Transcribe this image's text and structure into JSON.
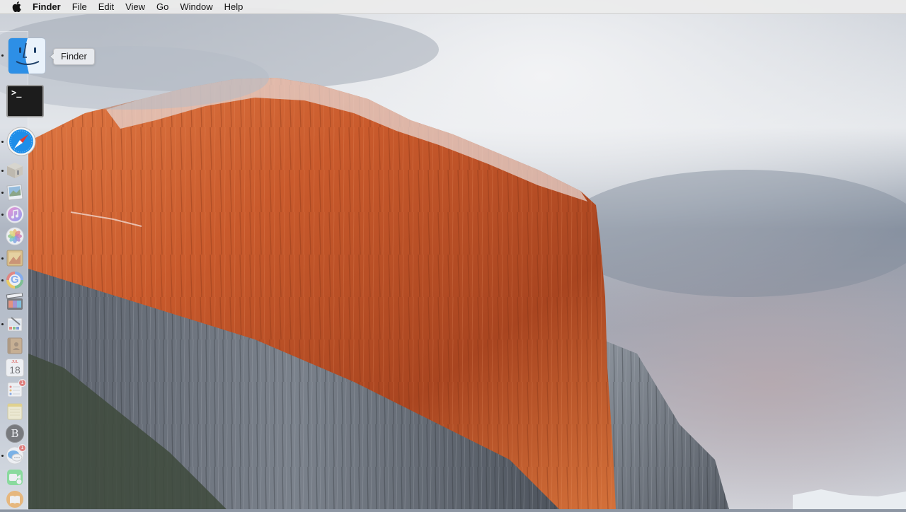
{
  "menubar": {
    "apple_icon": "apple-logo-icon",
    "app_name": "Finder",
    "items": [
      "File",
      "Edit",
      "View",
      "Go",
      "Window",
      "Help"
    ]
  },
  "dock": {
    "orientation": "left",
    "tooltip": "Finder",
    "items": [
      {
        "name": "Finder",
        "icon": "finder-icon",
        "running": true
      },
      {
        "name": "Terminal",
        "icon": "terminal-icon",
        "running": false,
        "glyph": ">_"
      },
      {
        "name": "Safari",
        "icon": "safari-icon",
        "running": true
      },
      {
        "name": "Archive",
        "icon": "archive-box-icon",
        "running": true
      },
      {
        "name": "Preview",
        "icon": "preview-icon",
        "running": true
      },
      {
        "name": "iTunes",
        "icon": "itunes-icon",
        "running": true
      },
      {
        "name": "Photos",
        "icon": "photos-icon",
        "running": false
      },
      {
        "name": "Image Viewer",
        "icon": "image-viewer-icon",
        "running": true
      },
      {
        "name": "Google Chrome",
        "icon": "google-icon",
        "running": true,
        "glyph": "G"
      },
      {
        "name": "Final Cut Pro",
        "icon": "final-cut-icon",
        "running": false
      },
      {
        "name": "Pixelmator",
        "icon": "paint-icon",
        "running": true
      },
      {
        "name": "Contacts",
        "icon": "contacts-book-icon",
        "running": false
      },
      {
        "name": "Calendar",
        "icon": "calendar-icon",
        "running": false,
        "month": "JUL",
        "day": "18"
      },
      {
        "name": "Reminders",
        "icon": "reminders-icon",
        "running": false,
        "badge": "1"
      },
      {
        "name": "Notes",
        "icon": "notes-icon",
        "running": false
      },
      {
        "name": "Bartender",
        "icon": "bartender-icon",
        "running": false,
        "glyph": "B"
      },
      {
        "name": "Messages",
        "icon": "messages-icon",
        "running": true,
        "badge": "1"
      },
      {
        "name": "FaceTime",
        "icon": "facetime-icon",
        "running": false
      },
      {
        "name": "iBooks",
        "icon": "ibooks-icon",
        "running": false
      }
    ]
  },
  "colors": {
    "menubar_bg": "#ececec",
    "rock_orange": "#c8582a",
    "rock_shadow": "#5f6670",
    "sky": "#9aa5b3",
    "badge_red": "#e5372e"
  }
}
